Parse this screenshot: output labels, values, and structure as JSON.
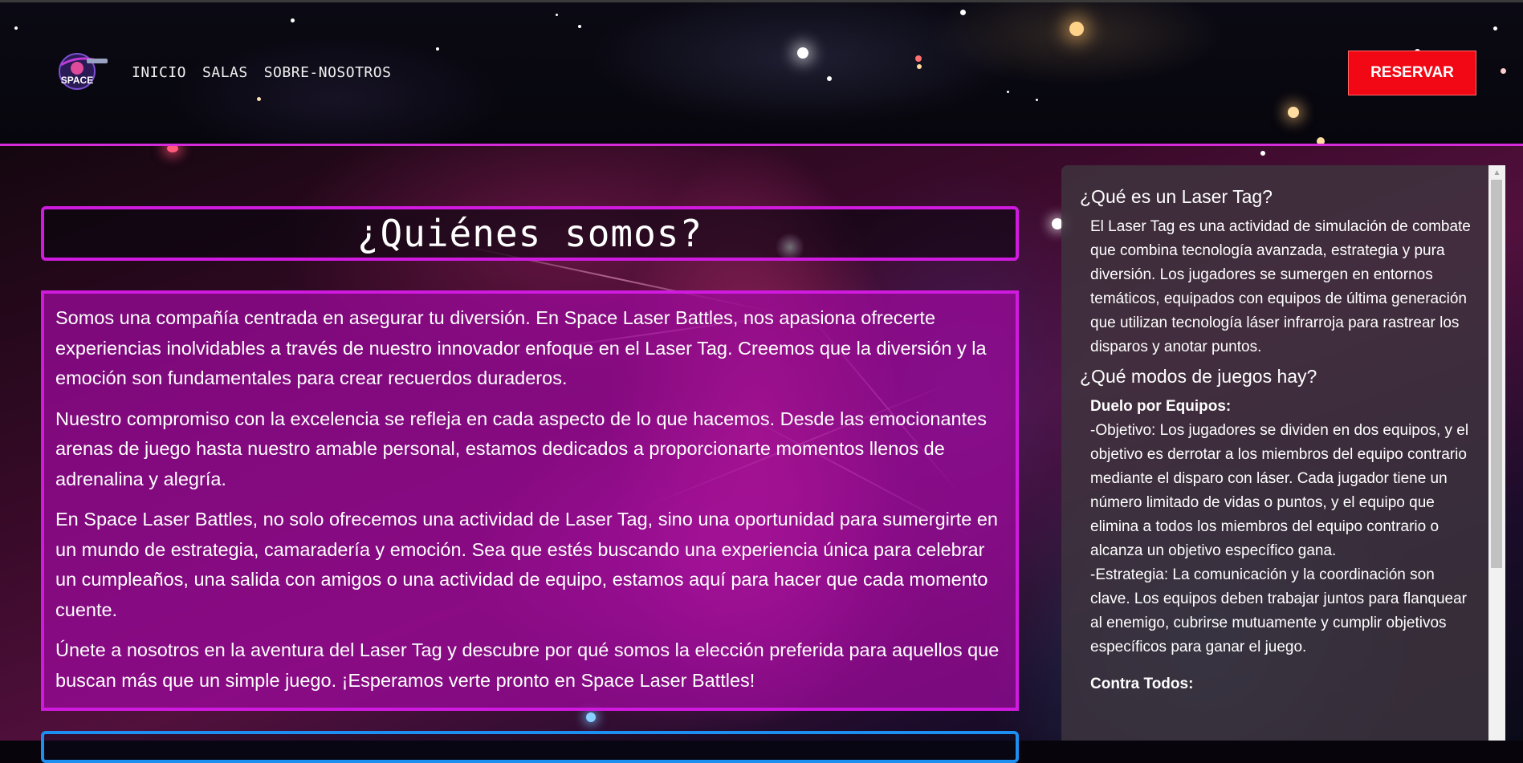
{
  "header": {
    "logo_text": "SPACE",
    "nav": [
      "INICIO",
      "SALAS",
      "SOBRE-NOSOTROS"
    ],
    "reserve_label": "RESERVAR"
  },
  "main": {
    "title": "¿Quiénes somos?",
    "paragraphs": [
      "Somos una compañía centrada en asegurar tu diversión. En Space Laser Battles, nos apasiona ofrecerte experiencias inolvidables a través de nuestro innovador enfoque en el Laser Tag. Creemos que la diversión y la emoción son fundamentales para crear recuerdos duraderos.",
      "Nuestro compromiso con la excelencia se refleja en cada aspecto de lo que hacemos. Desde las emocionantes arenas de juego hasta nuestro amable personal, estamos dedicados a proporcionarte momentos llenos de adrenalina y alegría.",
      "En Space Laser Battles, no solo ofrecemos una actividad de Laser Tag, sino una oportunidad para sumergirte en un mundo de estrategia, camaradería y emoción. Sea que estés buscando una experiencia única para celebrar un cumpleaños, una salida con amigos o una actividad de equipo, estamos aquí para hacer que cada momento cuente.",
      "Únete a nosotros en la aventura del Laser Tag y descubre por qué somos la elección preferida para aquellos que buscan más que un simple juego. ¡Esperamos verte pronto en Space Laser Battles!"
    ]
  },
  "sidebar": {
    "q1": "¿Qué es un Laser Tag?",
    "a1": "El Laser Tag es una actividad de simulación de combate que combina tecnología avanzada, estrategia y pura diversión. Los jugadores se sumergen en entornos temáticos, equipados con equipos de última generación que utilizan tecnología láser infrarroja para rastrear los disparos y anotar puntos.",
    "q2": "¿Qué modos de juegos hay?",
    "modes": [
      {
        "name": "Duelo por Equipos:",
        "objective": "-Objetivo: Los jugadores se dividen en dos equipos, y el objetivo es derrotar a los miembros del equipo contrario mediante el disparo con láser. Cada jugador tiene un número limitado de vidas o puntos, y el equipo que elimina a todos los miembros del equipo contrario o alcanza un objetivo específico gana.",
        "strategy": "-Estrategia: La comunicación y la coordinación son clave. Los equipos deben trabajar juntos para flanquear al enemigo, cubrirse mutuamente y cumplir objetivos específicos para ganar el juego."
      },
      {
        "name": "Contra Todos:"
      }
    ]
  },
  "colors": {
    "accent": "#d11ae0",
    "reserve": "#f20814",
    "blue_border": "#1c8ff0"
  }
}
